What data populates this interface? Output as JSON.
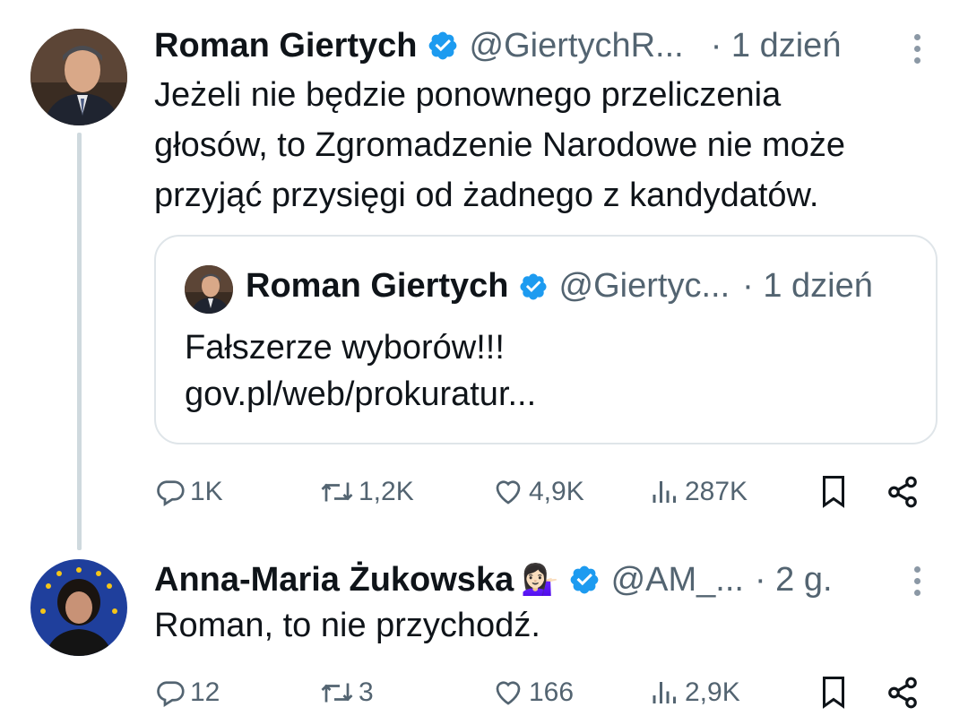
{
  "tweets": [
    {
      "author_name": "Roman Giertych",
      "handle": "@GiertychR...",
      "time": "· 1 dzień",
      "text_lines": [
        "Jeżeli nie będzie ponownego przeliczenia",
        "głosów, to Zgromadzenie Narodowe nie może",
        "przyjąć przysięgi od żadnego z kandydatów."
      ],
      "quote": {
        "author_name": "Roman Giertych",
        "handle": "@Giertyc...",
        "time": "· 1 dzień",
        "text_lines": [
          "Fałszerze wyborów!!!",
          "gov.pl/web/prokuratur..."
        ]
      },
      "stats": {
        "replies": "1K",
        "reposts": "1,2K",
        "likes": "4,9K",
        "views": "287K"
      }
    },
    {
      "author_name": "Anna-Maria Żukowska",
      "author_emoji": "💁🏻‍♀️",
      "handle": "@AM_...",
      "time": "· 2 g.",
      "text_lines": [
        "Roman, to nie przychodź."
      ],
      "stats": {
        "replies": "12",
        "reposts": "3",
        "likes": "166",
        "views": "2,9K"
      }
    }
  ],
  "icons": {
    "verified": "verified-badge-icon",
    "reply": "reply-icon",
    "repost": "repost-icon",
    "like": "heart-icon",
    "views": "views-icon",
    "bookmark": "bookmark-icon",
    "share": "share-icon",
    "more": "more-vertical-icon"
  },
  "colors": {
    "verified": "#1d9bf0",
    "secondary_text": "#536471",
    "thread_line": "#cfd9de"
  }
}
